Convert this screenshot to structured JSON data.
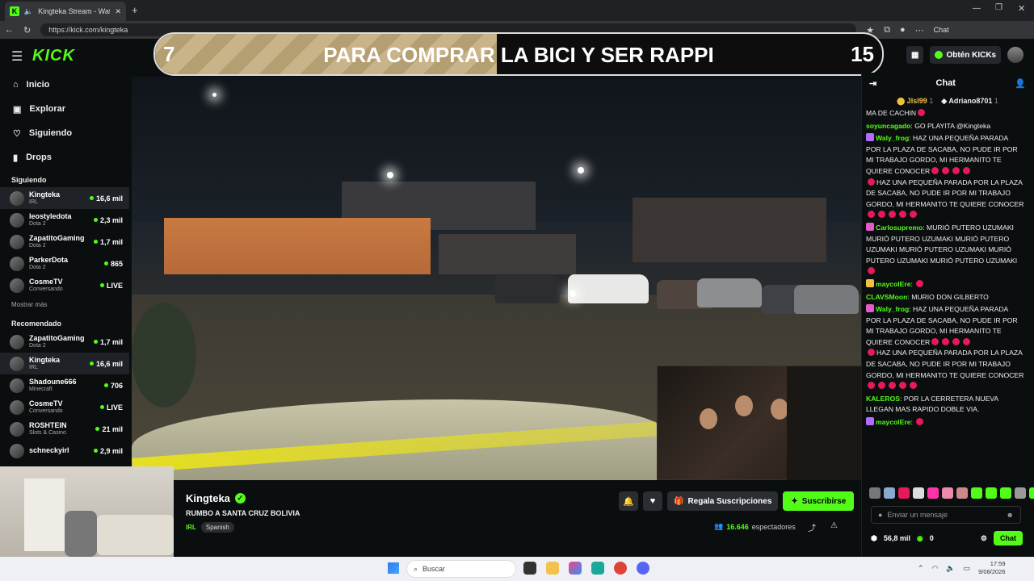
{
  "browser": {
    "tab_title": "Kingteka Stream - Watch Live",
    "url": "https://kick.com/kingteka",
    "chat_ext_label": "Chat"
  },
  "header": {
    "logo": "KICK",
    "get_kicks": "Obtén KICKs"
  },
  "banner": {
    "left_number": "7",
    "text": "PARA COMPRAR LA BICI Y SER RAPPI",
    "right_number": "15",
    "fill_fraction": 0.47
  },
  "sidebar": {
    "nav": [
      {
        "label": "Inicio",
        "icon": "home-icon"
      },
      {
        "label": "Explorar",
        "icon": "explore-icon"
      },
      {
        "label": "Siguiendo",
        "icon": "heart-icon"
      },
      {
        "label": "Drops",
        "icon": "drops-icon"
      }
    ],
    "following_title": "Siguiendo",
    "following": [
      {
        "name": "Kingteka",
        "category": "IRL",
        "viewers": "16,6 mil"
      },
      {
        "name": "leostyledota",
        "category": "Dota 2",
        "viewers": "2,3 mil"
      },
      {
        "name": "ZapatitoGaming",
        "category": "Dota 2",
        "viewers": "1,7 mil"
      },
      {
        "name": "ParkerDota",
        "category": "Dota 2",
        "viewers": "865"
      },
      {
        "name": "CosmeTV",
        "category": "Conversando",
        "viewers": "LIVE"
      }
    ],
    "show_more": "Mostrar más",
    "recommended_title": "Recomendado",
    "recommended": [
      {
        "name": "ZapatitoGaming",
        "category": "Dota 2",
        "viewers": "1,7 mil"
      },
      {
        "name": "Kingteka",
        "category": "IRL",
        "viewers": "16,6 mil"
      },
      {
        "name": "Shadoune666",
        "category": "Minecraft",
        "viewers": "706"
      },
      {
        "name": "CosmeTV",
        "category": "Conversando",
        "viewers": "LIVE"
      },
      {
        "name": "ROSHTEIN",
        "category": "Slots & Casino",
        "viewers": "21 mil"
      },
      {
        "name": "schneckyirl",
        "category": "",
        "viewers": "2,9 mil"
      }
    ]
  },
  "stream": {
    "streamer": "Kingteka",
    "title": "RUMBO A SANTA CRUZ BOLIVIA",
    "category": "IRL",
    "tag": "Spanish",
    "gift_label": "Regala Suscripciones",
    "subscribe_label": "Suscribirse",
    "viewers_count": "16.646",
    "viewers_label": "espectadores"
  },
  "chat": {
    "title": "Chat",
    "pinned": [
      {
        "user": "Jlsl99",
        "rank": "1"
      },
      {
        "user": "Adriano8701",
        "rank": "1"
      }
    ],
    "messages": [
      {
        "user": "",
        "color": "#eeeeee",
        "text": "MA DE CACHIN",
        "emotes": 1
      },
      {
        "user": "soyuncagado",
        "color": "#53fc18",
        "text": "GO PLAYITA @Kingteka",
        "emotes": 0
      },
      {
        "user": "Waly_frog",
        "color": "#53fc18",
        "text": "HAZ UNA PEQUEÑA PARADA POR LA PLAZA DE SACABA, NO PUDE IR POR MI TRABAJO GORDO, MI HERMANITO TE QUIERE CONOCER",
        "emotes": 4,
        "text2": "HAZ UNA PEQUEÑA PARADA POR LA PLAZA DE SACABA, NO PUDE IR POR MI TRABAJO GORDO, MI HERMANITO TE QUIERE CONOCER",
        "emotes2": 5
      },
      {
        "user": "Carlosupremo",
        "color": "#53fc18",
        "text": "MURIÓ PUTERO UZUMAKI MURIÓ PUTERO UZUMAKI MURIÓ PUTERO UZUMAKI MURIÓ PUTERO UZUMAKI MURIÓ PUTERO UZUMAKI MURIÓ PUTERO UZUMAKI",
        "emotes": 1
      },
      {
        "user": "maycolEre",
        "color": "#53fc18",
        "text": "",
        "emotes": 0
      },
      {
        "user": "CLAVSMoon",
        "color": "#53fc18",
        "text": "MURIO DON GILBERTO",
        "emotes": 0
      },
      {
        "user": "Waly_frog",
        "color": "#53fc18",
        "text": "HAZ UNA PEQUEÑA PARADA POR LA PLAZA DE SACABA, NO PUDE IR POR MI TRABAJO GORDO, MI HERMANITO TE QUIERE CONOCER",
        "emotes": 4,
        "text2": "HAZ UNA PEQUEÑA PARADA POR LA PLAZA DE SACABA, NO PUDE IR POR MI TRABAJO GORDO, MI HERMANITO TE QUIERE CONOCER",
        "emotes2": 5
      },
      {
        "user": "KALEROS",
        "color": "#53fc18",
        "text": "POR LA CERRETERA NUEVA LLEGAN MAS RAPIDO DOBLE VIA.",
        "emotes": 0
      },
      {
        "user": "maycolEre",
        "color": "#53fc18",
        "text": "",
        "emotes": 0
      }
    ],
    "input_placeholder": "Enviar un mensaje",
    "points": "56,8 mil",
    "kicks": "0",
    "send_label": "Chat"
  },
  "taskbar": {
    "search_placeholder": "Buscar",
    "time": "17:59",
    "date": "9/08/2026"
  }
}
